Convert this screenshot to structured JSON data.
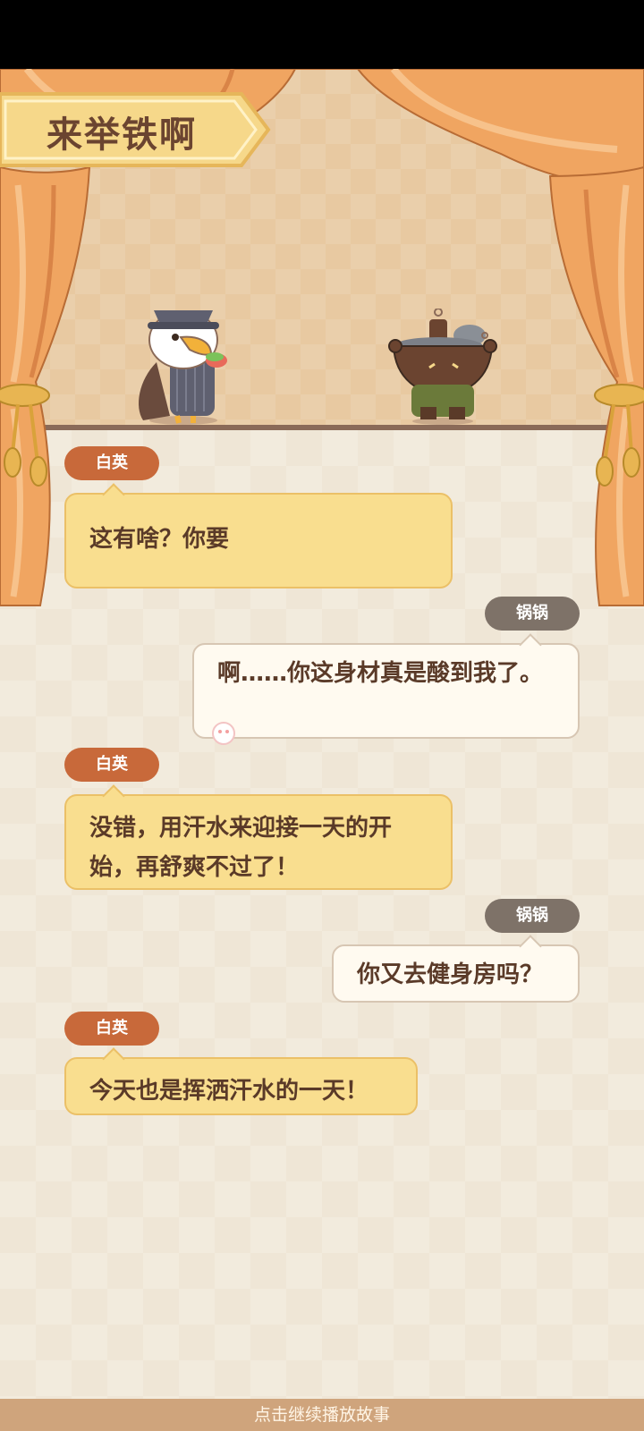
{
  "title": "来举铁啊",
  "characters": {
    "left_name": "白英",
    "right_name": "锅锅"
  },
  "dialogue": [
    {
      "speaker": "白英",
      "side": "left",
      "text": "这有啥？你要"
    },
    {
      "speaker": "锅锅",
      "side": "right",
      "text": "啊……你这身材真是酸到我了。"
    },
    {
      "speaker": "白英",
      "side": "left",
      "text": "没错，用汗水来迎接一天的开始，再舒爽不过了！"
    },
    {
      "speaker": "锅锅",
      "side": "right",
      "text": "你又去健身房吗？"
    },
    {
      "speaker": "白英",
      "side": "left",
      "text": "今天也是挥洒汗水的一天！"
    }
  ],
  "continue_label": "点击继续播放故事",
  "colors": {
    "left_tag": "#c8693a",
    "right_tag": "#7e7268",
    "left_bubble": "#f9de8f",
    "right_bubble": "#fffaf0",
    "curtain": "#f0a561",
    "bottom_bar": "#cfa47c"
  }
}
